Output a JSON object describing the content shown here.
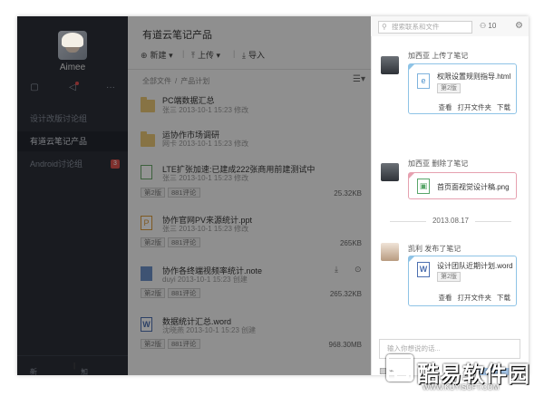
{
  "sidebar": {
    "username": "Aimee",
    "items": [
      {
        "label": "设计改版讨论组"
      },
      {
        "label": "有道云笔记产品"
      },
      {
        "label": "Android讨论组",
        "badge": "3"
      }
    ],
    "footer": {
      "new_group": "新建群",
      "join_group": "加入群"
    }
  },
  "main": {
    "title": "有道云笔记产品",
    "toolbar": {
      "new": "新建",
      "upload": "上传",
      "import": "导入"
    },
    "breadcrumb": {
      "root": "全部文件",
      "current": "产品计划"
    },
    "files": [
      {
        "name": "PC端数据汇总",
        "meta": "张三  2013-10-1 15:23  修改",
        "type": "folder"
      },
      {
        "name": "运协作市场调研",
        "meta": "网卡  2013-10-1 15:23  修改",
        "type": "folder"
      },
      {
        "name": "LTE扩张加速:已建成222张商用前建测试中",
        "meta": "张三  2013-10-1 15:23  修改",
        "version": "第2版",
        "comments": "881评论",
        "size": "25.32KB",
        "type": "sheet"
      },
      {
        "name": "协作官网PV来源统计.ppt",
        "meta": "张三  2013-10-1 15:23  修改",
        "version": "第2版",
        "comments": "881评论",
        "size": "265KB",
        "type": "ppt"
      },
      {
        "name": "协作各终端视频率统计.note",
        "meta": "duyi  2013-10-1 15:23  创建",
        "version": "第2版",
        "comments": "881评论",
        "size": "265.32KB",
        "type": "note"
      },
      {
        "name": "数据统计汇总.word",
        "meta": "沈晓燕  2013-10-1 15:23  创建",
        "version": "第2版",
        "comments": "881评论",
        "size": "968.30MB",
        "type": "word"
      }
    ]
  },
  "topbar": {
    "search_placeholder": "搜索联系和文件",
    "members": "10"
  },
  "activity": [
    {
      "actor_action": "加西亚 上传了笔记",
      "file": "权限设置规则指导.html",
      "version": "第2版",
      "actions": [
        "查看",
        "打开文件夹",
        "下载"
      ]
    },
    {
      "actor_action": "加西亚 删除了笔记",
      "file": "首页面视觉设计稿.png"
    },
    {
      "date": "2013.08.17"
    },
    {
      "actor_action": "凯利 发布了笔记",
      "file": "设计团队近期计划.word",
      "version": "第2版",
      "actions": [
        "查看",
        "打开文件夹",
        "下载"
      ]
    }
  ],
  "comment_placeholder": "输入你想说的话...",
  "watermark": {
    "text": "酷易软件园",
    "url": "WWW.KUYISOFT.COM"
  }
}
